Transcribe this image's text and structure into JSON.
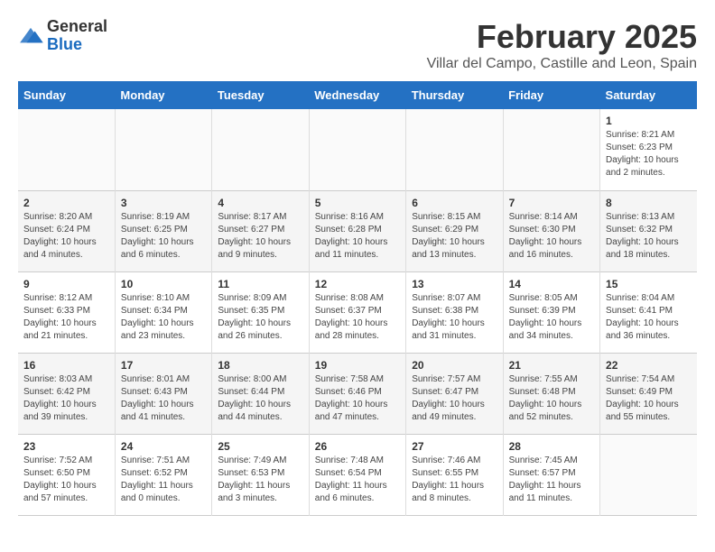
{
  "header": {
    "logo_line1": "General",
    "logo_line2": "Blue",
    "title": "February 2025",
    "subtitle": "Villar del Campo, Castille and Leon, Spain"
  },
  "weekdays": [
    "Sunday",
    "Monday",
    "Tuesday",
    "Wednesday",
    "Thursday",
    "Friday",
    "Saturday"
  ],
  "weeks": [
    [
      {
        "day": "",
        "info": ""
      },
      {
        "day": "",
        "info": ""
      },
      {
        "day": "",
        "info": ""
      },
      {
        "day": "",
        "info": ""
      },
      {
        "day": "",
        "info": ""
      },
      {
        "day": "",
        "info": ""
      },
      {
        "day": "1",
        "info": "Sunrise: 8:21 AM\nSunset: 6:23 PM\nDaylight: 10 hours and 2 minutes."
      }
    ],
    [
      {
        "day": "2",
        "info": "Sunrise: 8:20 AM\nSunset: 6:24 PM\nDaylight: 10 hours and 4 minutes."
      },
      {
        "day": "3",
        "info": "Sunrise: 8:19 AM\nSunset: 6:25 PM\nDaylight: 10 hours and 6 minutes."
      },
      {
        "day": "4",
        "info": "Sunrise: 8:17 AM\nSunset: 6:27 PM\nDaylight: 10 hours and 9 minutes."
      },
      {
        "day": "5",
        "info": "Sunrise: 8:16 AM\nSunset: 6:28 PM\nDaylight: 10 hours and 11 minutes."
      },
      {
        "day": "6",
        "info": "Sunrise: 8:15 AM\nSunset: 6:29 PM\nDaylight: 10 hours and 13 minutes."
      },
      {
        "day": "7",
        "info": "Sunrise: 8:14 AM\nSunset: 6:30 PM\nDaylight: 10 hours and 16 minutes."
      },
      {
        "day": "8",
        "info": "Sunrise: 8:13 AM\nSunset: 6:32 PM\nDaylight: 10 hours and 18 minutes."
      }
    ],
    [
      {
        "day": "9",
        "info": "Sunrise: 8:12 AM\nSunset: 6:33 PM\nDaylight: 10 hours and 21 minutes."
      },
      {
        "day": "10",
        "info": "Sunrise: 8:10 AM\nSunset: 6:34 PM\nDaylight: 10 hours and 23 minutes."
      },
      {
        "day": "11",
        "info": "Sunrise: 8:09 AM\nSunset: 6:35 PM\nDaylight: 10 hours and 26 minutes."
      },
      {
        "day": "12",
        "info": "Sunrise: 8:08 AM\nSunset: 6:37 PM\nDaylight: 10 hours and 28 minutes."
      },
      {
        "day": "13",
        "info": "Sunrise: 8:07 AM\nSunset: 6:38 PM\nDaylight: 10 hours and 31 minutes."
      },
      {
        "day": "14",
        "info": "Sunrise: 8:05 AM\nSunset: 6:39 PM\nDaylight: 10 hours and 34 minutes."
      },
      {
        "day": "15",
        "info": "Sunrise: 8:04 AM\nSunset: 6:41 PM\nDaylight: 10 hours and 36 minutes."
      }
    ],
    [
      {
        "day": "16",
        "info": "Sunrise: 8:03 AM\nSunset: 6:42 PM\nDaylight: 10 hours and 39 minutes."
      },
      {
        "day": "17",
        "info": "Sunrise: 8:01 AM\nSunset: 6:43 PM\nDaylight: 10 hours and 41 minutes."
      },
      {
        "day": "18",
        "info": "Sunrise: 8:00 AM\nSunset: 6:44 PM\nDaylight: 10 hours and 44 minutes."
      },
      {
        "day": "19",
        "info": "Sunrise: 7:58 AM\nSunset: 6:46 PM\nDaylight: 10 hours and 47 minutes."
      },
      {
        "day": "20",
        "info": "Sunrise: 7:57 AM\nSunset: 6:47 PM\nDaylight: 10 hours and 49 minutes."
      },
      {
        "day": "21",
        "info": "Sunrise: 7:55 AM\nSunset: 6:48 PM\nDaylight: 10 hours and 52 minutes."
      },
      {
        "day": "22",
        "info": "Sunrise: 7:54 AM\nSunset: 6:49 PM\nDaylight: 10 hours and 55 minutes."
      }
    ],
    [
      {
        "day": "23",
        "info": "Sunrise: 7:52 AM\nSunset: 6:50 PM\nDaylight: 10 hours and 57 minutes."
      },
      {
        "day": "24",
        "info": "Sunrise: 7:51 AM\nSunset: 6:52 PM\nDaylight: 11 hours and 0 minutes."
      },
      {
        "day": "25",
        "info": "Sunrise: 7:49 AM\nSunset: 6:53 PM\nDaylight: 11 hours and 3 minutes."
      },
      {
        "day": "26",
        "info": "Sunrise: 7:48 AM\nSunset: 6:54 PM\nDaylight: 11 hours and 6 minutes."
      },
      {
        "day": "27",
        "info": "Sunrise: 7:46 AM\nSunset: 6:55 PM\nDaylight: 11 hours and 8 minutes."
      },
      {
        "day": "28",
        "info": "Sunrise: 7:45 AM\nSunset: 6:57 PM\nDaylight: 11 hours and 11 minutes."
      },
      {
        "day": "",
        "info": ""
      }
    ]
  ]
}
